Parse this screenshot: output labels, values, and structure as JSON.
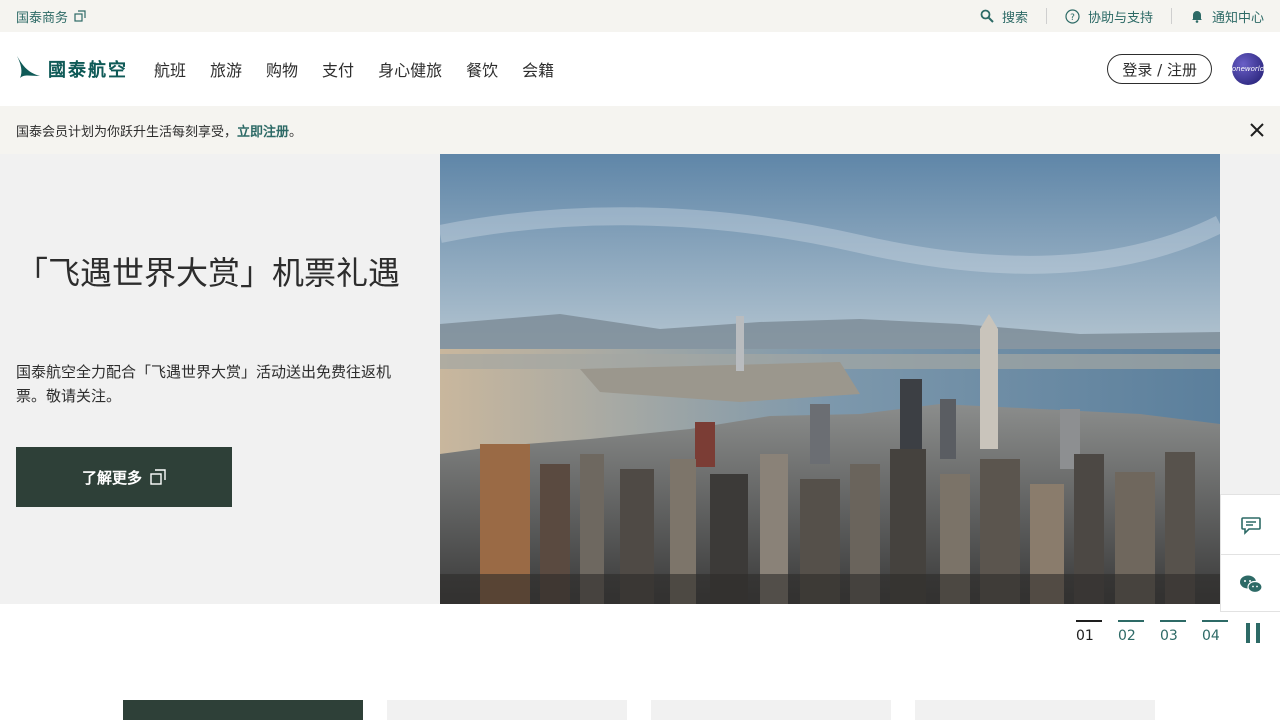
{
  "utility": {
    "business_label": "国泰商务",
    "search_label": "搜索",
    "help_label": "协助与支持",
    "notify_label": "通知中心"
  },
  "header": {
    "logo_text": "國泰航空",
    "nav": [
      "航班",
      "旅游",
      "购物",
      "支付",
      "身心健旅",
      "餐饮",
      "会籍"
    ],
    "login_label": "登录 / 注册",
    "oneworld_label": "oneworld"
  },
  "notice": {
    "text": "国泰会员计划为你跃升生活每刻享受，",
    "link": "立即注册",
    "end": "。"
  },
  "hero": {
    "title": "「飞遇世界大赏」机票礼遇",
    "description": "国泰航空全力配合「飞遇世界大赏」活动送出免费往返机票。敬请关注。",
    "cta_label": "了解更多"
  },
  "pager": {
    "items": [
      "01",
      "02",
      "03",
      "04"
    ],
    "active_index": 0
  },
  "colors": {
    "brand": "#2d6a66",
    "cta": "#2e4038",
    "bar": "#f5f4f0"
  }
}
